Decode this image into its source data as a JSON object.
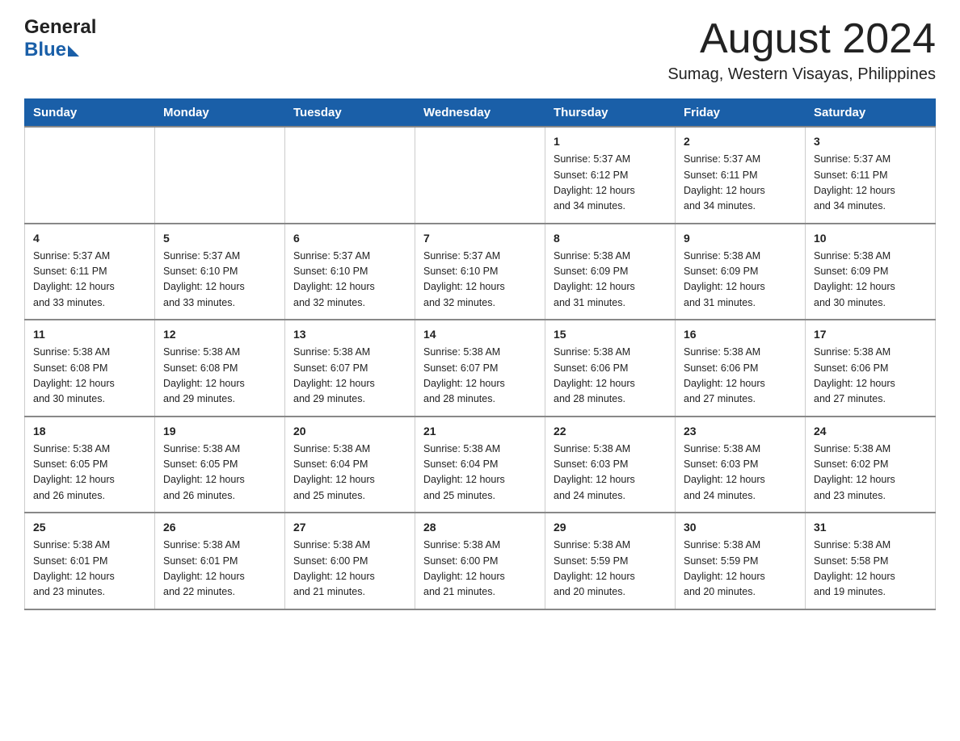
{
  "header": {
    "logo_general": "General",
    "logo_blue": "Blue",
    "month_title": "August 2024",
    "location": "Sumag, Western Visayas, Philippines"
  },
  "weekdays": [
    "Sunday",
    "Monday",
    "Tuesday",
    "Wednesday",
    "Thursday",
    "Friday",
    "Saturday"
  ],
  "weeks": [
    [
      {
        "day": "",
        "info": ""
      },
      {
        "day": "",
        "info": ""
      },
      {
        "day": "",
        "info": ""
      },
      {
        "day": "",
        "info": ""
      },
      {
        "day": "1",
        "info": "Sunrise: 5:37 AM\nSunset: 6:12 PM\nDaylight: 12 hours\nand 34 minutes."
      },
      {
        "day": "2",
        "info": "Sunrise: 5:37 AM\nSunset: 6:11 PM\nDaylight: 12 hours\nand 34 minutes."
      },
      {
        "day": "3",
        "info": "Sunrise: 5:37 AM\nSunset: 6:11 PM\nDaylight: 12 hours\nand 34 minutes."
      }
    ],
    [
      {
        "day": "4",
        "info": "Sunrise: 5:37 AM\nSunset: 6:11 PM\nDaylight: 12 hours\nand 33 minutes."
      },
      {
        "day": "5",
        "info": "Sunrise: 5:37 AM\nSunset: 6:10 PM\nDaylight: 12 hours\nand 33 minutes."
      },
      {
        "day": "6",
        "info": "Sunrise: 5:37 AM\nSunset: 6:10 PM\nDaylight: 12 hours\nand 32 minutes."
      },
      {
        "day": "7",
        "info": "Sunrise: 5:37 AM\nSunset: 6:10 PM\nDaylight: 12 hours\nand 32 minutes."
      },
      {
        "day": "8",
        "info": "Sunrise: 5:38 AM\nSunset: 6:09 PM\nDaylight: 12 hours\nand 31 minutes."
      },
      {
        "day": "9",
        "info": "Sunrise: 5:38 AM\nSunset: 6:09 PM\nDaylight: 12 hours\nand 31 minutes."
      },
      {
        "day": "10",
        "info": "Sunrise: 5:38 AM\nSunset: 6:09 PM\nDaylight: 12 hours\nand 30 minutes."
      }
    ],
    [
      {
        "day": "11",
        "info": "Sunrise: 5:38 AM\nSunset: 6:08 PM\nDaylight: 12 hours\nand 30 minutes."
      },
      {
        "day": "12",
        "info": "Sunrise: 5:38 AM\nSunset: 6:08 PM\nDaylight: 12 hours\nand 29 minutes."
      },
      {
        "day": "13",
        "info": "Sunrise: 5:38 AM\nSunset: 6:07 PM\nDaylight: 12 hours\nand 29 minutes."
      },
      {
        "day": "14",
        "info": "Sunrise: 5:38 AM\nSunset: 6:07 PM\nDaylight: 12 hours\nand 28 minutes."
      },
      {
        "day": "15",
        "info": "Sunrise: 5:38 AM\nSunset: 6:06 PM\nDaylight: 12 hours\nand 28 minutes."
      },
      {
        "day": "16",
        "info": "Sunrise: 5:38 AM\nSunset: 6:06 PM\nDaylight: 12 hours\nand 27 minutes."
      },
      {
        "day": "17",
        "info": "Sunrise: 5:38 AM\nSunset: 6:06 PM\nDaylight: 12 hours\nand 27 minutes."
      }
    ],
    [
      {
        "day": "18",
        "info": "Sunrise: 5:38 AM\nSunset: 6:05 PM\nDaylight: 12 hours\nand 26 minutes."
      },
      {
        "day": "19",
        "info": "Sunrise: 5:38 AM\nSunset: 6:05 PM\nDaylight: 12 hours\nand 26 minutes."
      },
      {
        "day": "20",
        "info": "Sunrise: 5:38 AM\nSunset: 6:04 PM\nDaylight: 12 hours\nand 25 minutes."
      },
      {
        "day": "21",
        "info": "Sunrise: 5:38 AM\nSunset: 6:04 PM\nDaylight: 12 hours\nand 25 minutes."
      },
      {
        "day": "22",
        "info": "Sunrise: 5:38 AM\nSunset: 6:03 PM\nDaylight: 12 hours\nand 24 minutes."
      },
      {
        "day": "23",
        "info": "Sunrise: 5:38 AM\nSunset: 6:03 PM\nDaylight: 12 hours\nand 24 minutes."
      },
      {
        "day": "24",
        "info": "Sunrise: 5:38 AM\nSunset: 6:02 PM\nDaylight: 12 hours\nand 23 minutes."
      }
    ],
    [
      {
        "day": "25",
        "info": "Sunrise: 5:38 AM\nSunset: 6:01 PM\nDaylight: 12 hours\nand 23 minutes."
      },
      {
        "day": "26",
        "info": "Sunrise: 5:38 AM\nSunset: 6:01 PM\nDaylight: 12 hours\nand 22 minutes."
      },
      {
        "day": "27",
        "info": "Sunrise: 5:38 AM\nSunset: 6:00 PM\nDaylight: 12 hours\nand 21 minutes."
      },
      {
        "day": "28",
        "info": "Sunrise: 5:38 AM\nSunset: 6:00 PM\nDaylight: 12 hours\nand 21 minutes."
      },
      {
        "day": "29",
        "info": "Sunrise: 5:38 AM\nSunset: 5:59 PM\nDaylight: 12 hours\nand 20 minutes."
      },
      {
        "day": "30",
        "info": "Sunrise: 5:38 AM\nSunset: 5:59 PM\nDaylight: 12 hours\nand 20 minutes."
      },
      {
        "day": "31",
        "info": "Sunrise: 5:38 AM\nSunset: 5:58 PM\nDaylight: 12 hours\nand 19 minutes."
      }
    ]
  ]
}
